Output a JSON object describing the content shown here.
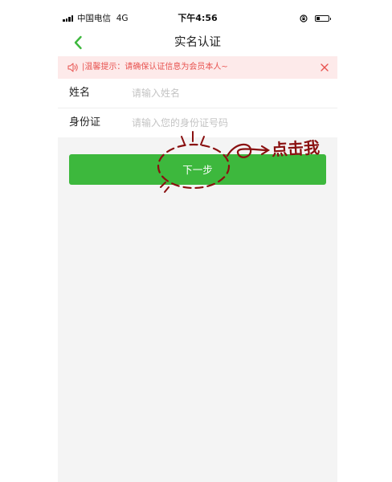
{
  "status_bar": {
    "carrier": "中国电信",
    "network": "4G",
    "time": "下午4:56"
  },
  "nav": {
    "title": "实名认证"
  },
  "notice": {
    "text": "|温馨提示：请确保认证信息为会员本人~"
  },
  "form": {
    "fields": [
      {
        "label": "姓名",
        "placeholder": "请输入姓名",
        "value": ""
      },
      {
        "label": "身份证",
        "placeholder": "请输入您的身份证号码",
        "value": ""
      }
    ]
  },
  "next_button": {
    "label": "下一步"
  },
  "annotation": {
    "text": "点击我"
  },
  "colors": {
    "accent_green": "#3db83d",
    "notice_red": "#e8524f",
    "notice_bg": "#fdeaea",
    "annotation_red": "#8a1010",
    "page_bg": "#f4f4f4"
  },
  "icons": {
    "back": "chevron-left-icon",
    "notice": "speaker-icon",
    "close": "close-icon",
    "rotation_lock": "rotation-lock-icon",
    "battery": "battery-icon",
    "signal": "signal-icon"
  }
}
